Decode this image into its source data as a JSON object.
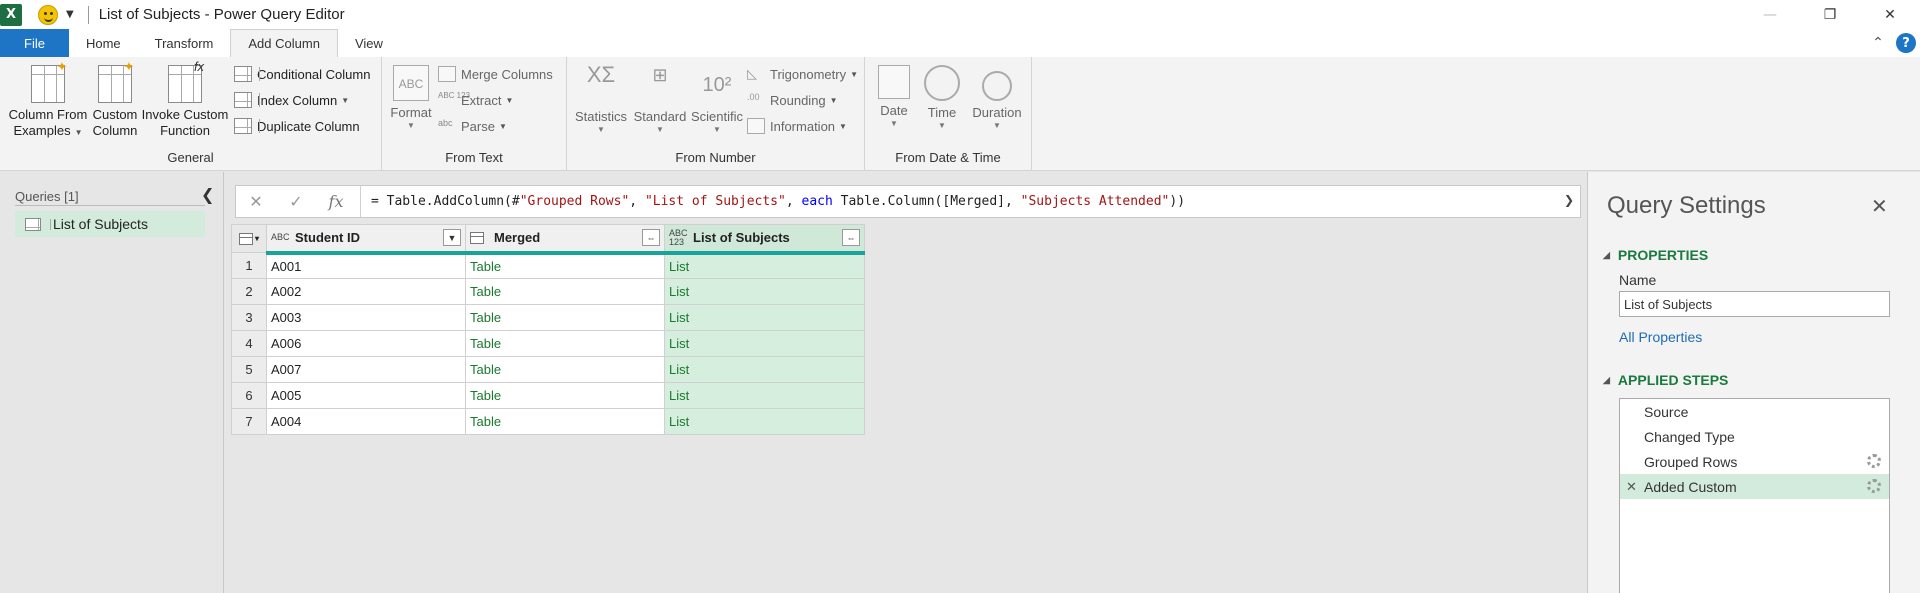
{
  "app": {
    "title": "List of Subjects - Power Query Editor",
    "logo": "X"
  },
  "window_controls": {
    "minimize": "—",
    "restore": "❐",
    "close": "✕"
  },
  "tabs": [
    {
      "label": "File"
    },
    {
      "label": "Home"
    },
    {
      "label": "Transform"
    },
    {
      "label": "Add Column"
    },
    {
      "label": "View"
    }
  ],
  "help": "?",
  "ribbon": {
    "general": {
      "label": "General",
      "column_from_examples_1": "Column From",
      "column_from_examples_2": "Examples",
      "custom_column_1": "Custom",
      "custom_column_2": "Column",
      "invoke_custom_function_1": "Invoke Custom",
      "invoke_custom_function_2": "Function",
      "conditional_column": "Conditional Column",
      "index_column": "Index Column",
      "duplicate_column": "Duplicate Column"
    },
    "from_text": {
      "label": "From Text",
      "format": "Format",
      "merge_columns": "Merge Columns",
      "extract": "Extract",
      "parse": "Parse"
    },
    "from_number": {
      "label": "From Number",
      "statistics": "Statistics",
      "standard": "Standard",
      "scientific": "Scientific",
      "trigonometry": "Trigonometry",
      "rounding": "Rounding",
      "information": "Information"
    },
    "from_date_time": {
      "label": "From Date & Time",
      "date": "Date",
      "time": "Time",
      "duration": "Duration"
    }
  },
  "formula": {
    "prefix": "= Table.AddColumn(#",
    "s1": "\"Grouped Rows\"",
    "c1": ", ",
    "s2": "\"List of Subjects\"",
    "c2": ", ",
    "kw": "each",
    "c3": " Table.Column([Merged], ",
    "s3": "\"Subjects Attended\"",
    "c4": "))"
  },
  "queries": {
    "header": "Queries [1]",
    "items": [
      {
        "label": "List of Subjects"
      }
    ]
  },
  "grid": {
    "columns": [
      {
        "name": "Student ID",
        "type": "ABC"
      },
      {
        "name": "Merged",
        "type": "table"
      },
      {
        "name": "List of Subjects",
        "type": "ABC 123"
      }
    ],
    "rows": [
      {
        "n": "1",
        "id": "A001",
        "merged": "Table",
        "list": "List"
      },
      {
        "n": "2",
        "id": "A002",
        "merged": "Table",
        "list": "List"
      },
      {
        "n": "3",
        "id": "A003",
        "merged": "Table",
        "list": "List"
      },
      {
        "n": "4",
        "id": "A006",
        "merged": "Table",
        "list": "List"
      },
      {
        "n": "5",
        "id": "A007",
        "merged": "Table",
        "list": "List"
      },
      {
        "n": "6",
        "id": "A005",
        "merged": "Table",
        "list": "List"
      },
      {
        "n": "7",
        "id": "A004",
        "merged": "Table",
        "list": "List"
      }
    ]
  },
  "settings": {
    "title": "Query Settings",
    "properties_header": "PROPERTIES",
    "name_label": "Name",
    "name_value": "List of Subjects",
    "all_properties": "All Properties",
    "applied_steps_header": "APPLIED STEPS",
    "steps": [
      {
        "label": "Source"
      },
      {
        "label": "Changed Type"
      },
      {
        "label": "Grouped Rows"
      },
      {
        "label": "Added Custom"
      }
    ]
  }
}
